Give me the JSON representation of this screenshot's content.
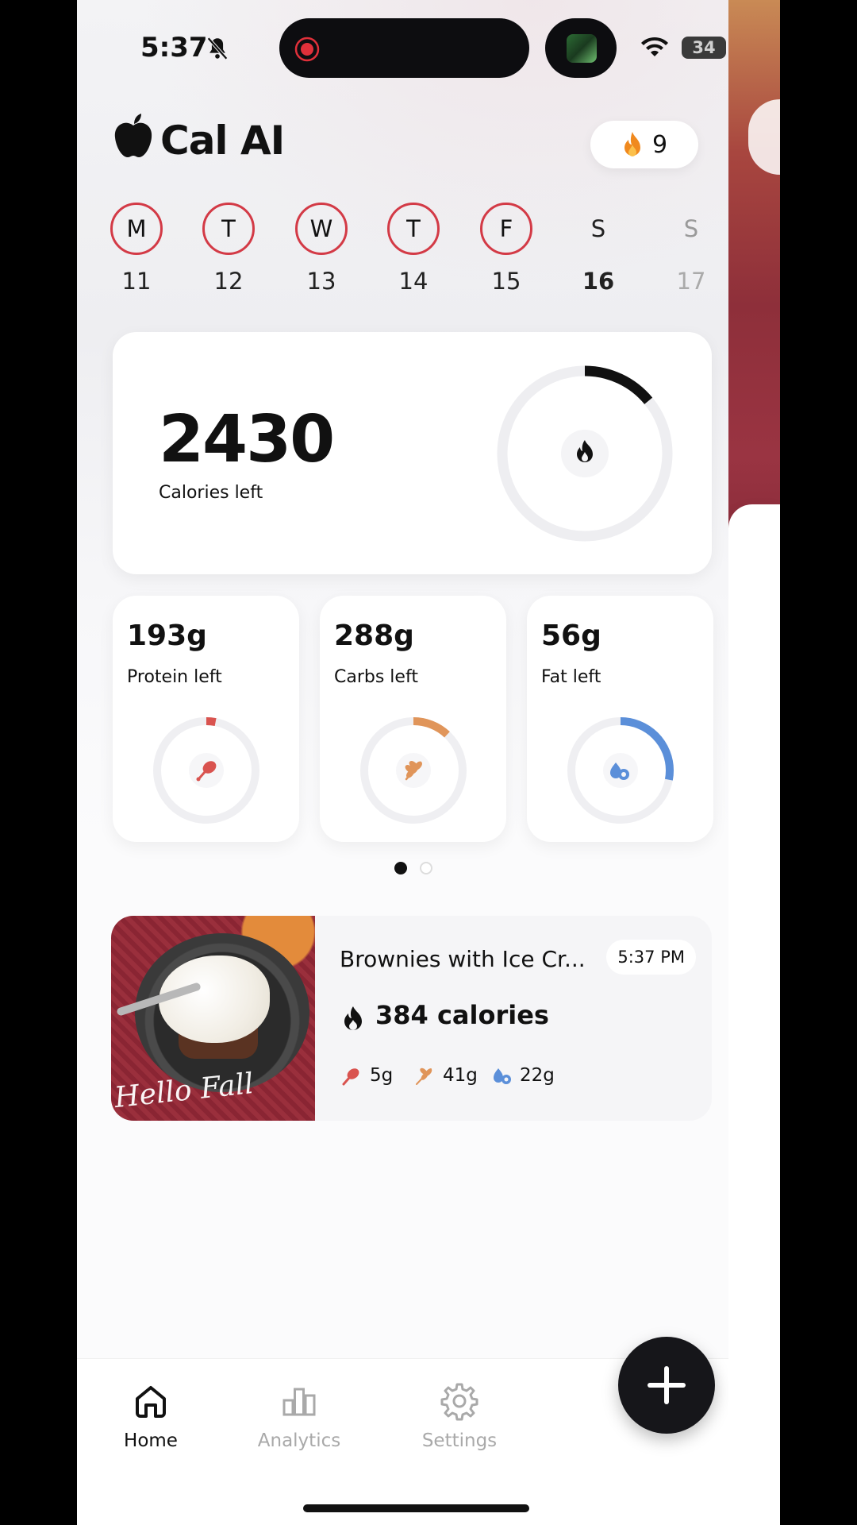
{
  "status_bar": {
    "time": "5:37",
    "battery": "34"
  },
  "header": {
    "title": "Cal AI",
    "streak_count": "9"
  },
  "week": [
    {
      "letter": "M",
      "date": "11",
      "state": "logged"
    },
    {
      "letter": "T",
      "date": "12",
      "state": "logged"
    },
    {
      "letter": "W",
      "date": "13",
      "state": "logged"
    },
    {
      "letter": "T",
      "date": "14",
      "state": "logged"
    },
    {
      "letter": "F",
      "date": "15",
      "state": "logged"
    },
    {
      "letter": "S",
      "date": "16",
      "state": "today"
    },
    {
      "letter": "S",
      "date": "17",
      "state": "future"
    }
  ],
  "calories": {
    "value": "2430",
    "label": "Calories left",
    "progress": 0.14
  },
  "macros": {
    "protein": {
      "value": "193g",
      "label": "Protein left",
      "progress": 0.03,
      "color": "#d9534f",
      "icon": "drumstick-icon"
    },
    "carbs": {
      "value": "288g",
      "label": "Carbs left",
      "progress": 0.12,
      "color": "#e0955a",
      "icon": "wheat-icon"
    },
    "fat": {
      "value": "56g",
      "label": "Fat left",
      "progress": 0.28,
      "color": "#5b8fd9",
      "icon": "oil-drop-icon"
    }
  },
  "pager": {
    "pages": 2,
    "current": 1
  },
  "meal": {
    "name": "Brownies with Ice Cr...",
    "time": "5:37 PM",
    "calories": "384 calories",
    "protein": "5g",
    "carbs": "41g",
    "fat": "22g",
    "photo_caption": "Hello Fall"
  },
  "tabbar": {
    "home": "Home",
    "analytics": "Analytics",
    "settings": "Settings"
  },
  "colors": {
    "accent": "#d33a46",
    "dark": "#16161a",
    "inactive": "#a9a9a9"
  }
}
